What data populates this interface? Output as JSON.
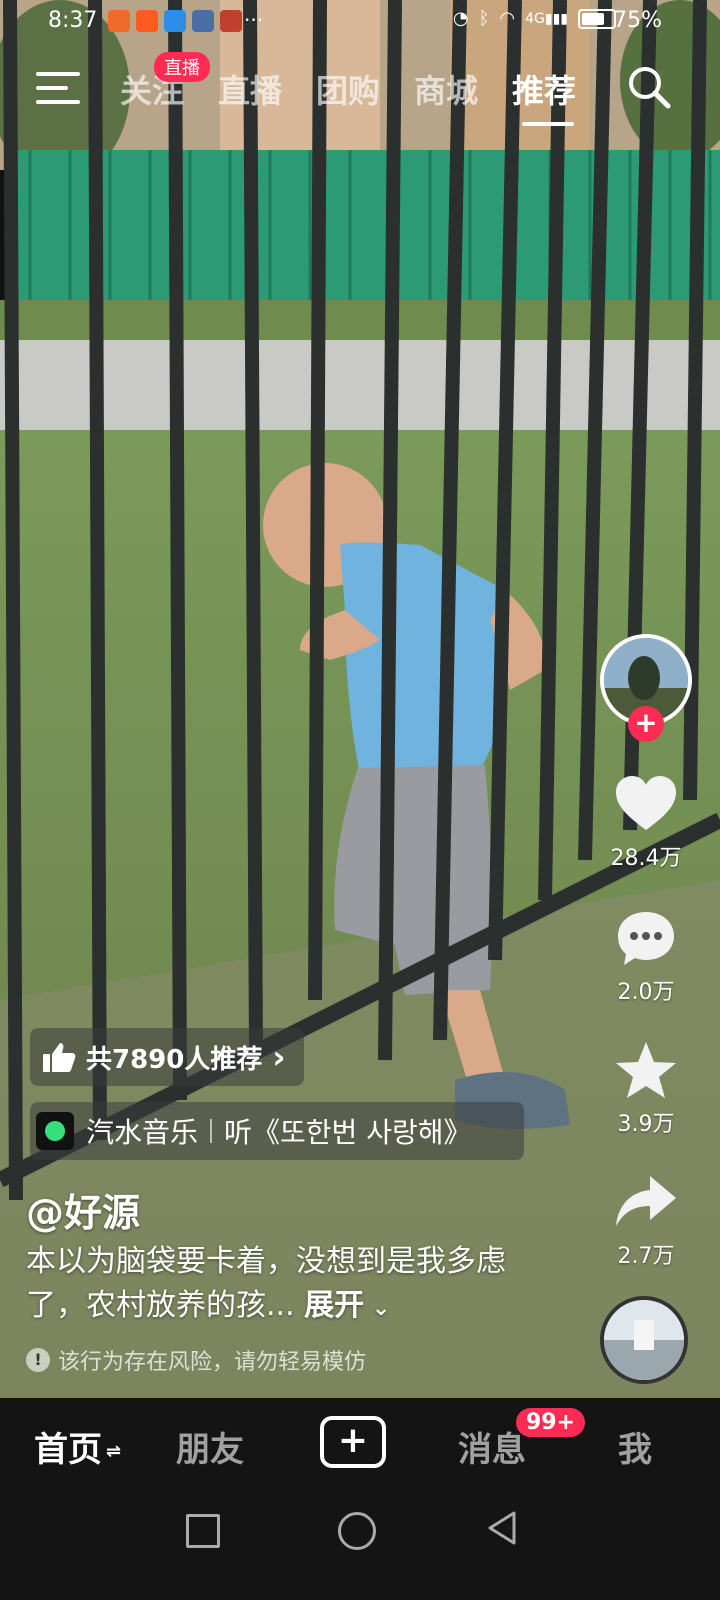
{
  "status_bar": {
    "time": "8:37",
    "overflow": "···",
    "network": "4G",
    "battery": "75%"
  },
  "top_nav": {
    "tabs": [
      "关注",
      "直播",
      "团购",
      "商城",
      "推荐"
    ],
    "active_tab": "推荐",
    "live_badge": "直播"
  },
  "actions": {
    "likes": "28.4万",
    "comments": "2.0万",
    "favorites": "3.9万",
    "shares": "2.7万",
    "follow_plus": "+"
  },
  "video_info": {
    "recommend": "共7890人推荐",
    "recommend_arrow": "›",
    "music_app": "汽水音乐",
    "music_track": "听《또한번 사랑해》",
    "author": "@好源",
    "description": "本以为脑袋要卡着，没想到是我多虑了，农村放养的孩...",
    "expand": "展开",
    "warning": "该行为存在风险，请勿轻易模仿"
  },
  "tab_bar": {
    "home": "首页",
    "friends": "朋友",
    "create": "+",
    "messages": "消息",
    "messages_badge": "99+",
    "me": "我"
  },
  "colors": {
    "accent": "#fe2c55",
    "tabbar_bg": "#141414"
  },
  "icons": [
    "menu-icon",
    "search-icon",
    "heart-icon",
    "comment-icon",
    "star-icon",
    "share-icon",
    "thumb-icon",
    "chevron-right-icon",
    "chevron-down-icon",
    "warning-icon"
  ]
}
